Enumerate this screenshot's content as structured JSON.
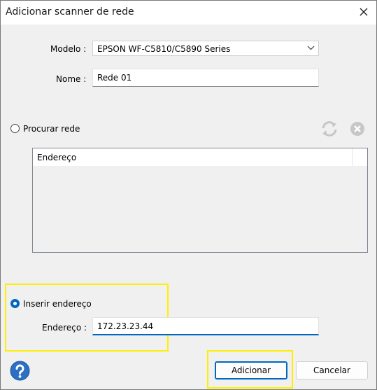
{
  "window": {
    "title": "Adicionar scanner de rede"
  },
  "form": {
    "model_label": "Modelo :",
    "model_value": "EPSON WF-C5810/C5890 Series",
    "name_label": "Nome :",
    "name_value": "Rede 01"
  },
  "search": {
    "radio_label": "Procurar rede",
    "selected": false,
    "column_header": "Endereço",
    "refresh_icon": "refresh-icon",
    "cancel_icon": "cancel-circle-icon"
  },
  "manual": {
    "radio_label": "Inserir endereço",
    "selected": true,
    "address_label": "Endereço :",
    "address_value": "172.23.23.44"
  },
  "buttons": {
    "add_label": "Adicionar",
    "cancel_label": "Cancelar"
  },
  "colors": {
    "accent": "#0067c0",
    "highlight": "#ffee00",
    "help_icon_bg": "#2d6fc3",
    "disabled_icon": "#c7c7c7"
  }
}
